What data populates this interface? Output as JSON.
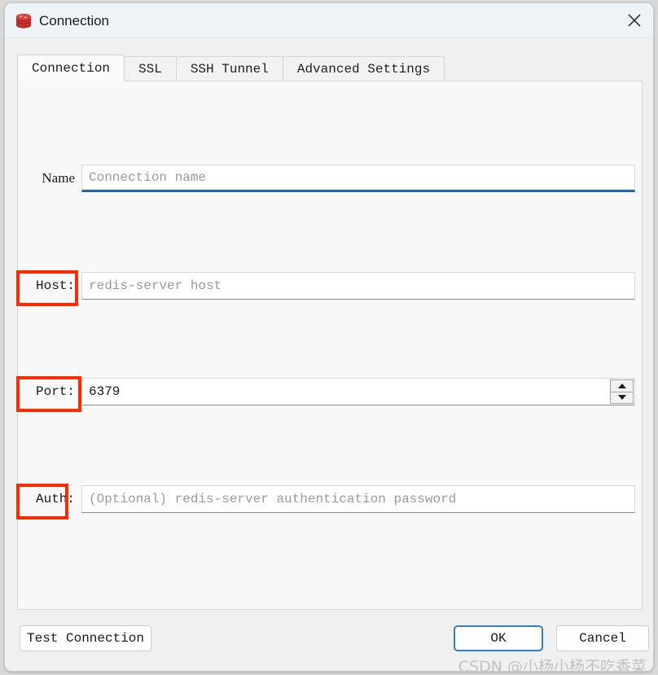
{
  "window": {
    "title": "Connection",
    "icon": "redis-logo-icon",
    "close_label": "×"
  },
  "tabs": [
    {
      "label": "Connection",
      "active": true
    },
    {
      "label": "SSL",
      "active": false
    },
    {
      "label": "SSH Tunnel",
      "active": false
    },
    {
      "label": "Advanced Settings",
      "active": false
    }
  ],
  "form": {
    "name": {
      "label": "Name",
      "value": "",
      "placeholder": "Connection name",
      "focused": true
    },
    "host": {
      "label": "Host:",
      "value": "",
      "placeholder": "redis-server host",
      "annotated": true
    },
    "port": {
      "label": "Port:",
      "value": "6379",
      "placeholder": "",
      "annotated": true,
      "spinner_up": "▲",
      "spinner_down": "▼"
    },
    "auth": {
      "label": "Auth:",
      "value": "",
      "placeholder": "(Optional) redis-server authentication password",
      "annotated": true
    }
  },
  "footer": {
    "test_connection": "Test Connection",
    "ok": "OK",
    "cancel": "Cancel"
  },
  "watermark": "CSDN @小杨小杨不吃香菜",
  "colors": {
    "annotation_red": "#fc2b00",
    "focus_blue": "#1667b8",
    "default_button_blue": "#2f7fd1",
    "titlebar_bg": "#eef3f7",
    "panel_bg": "#f8f8f8",
    "redis_red": "#c6302b"
  }
}
